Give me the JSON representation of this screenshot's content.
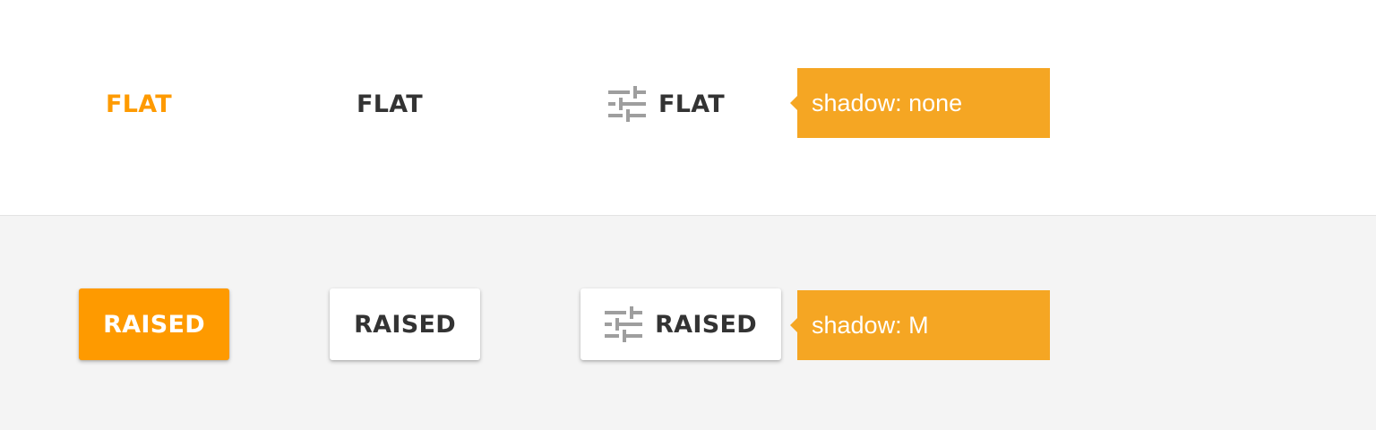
{
  "flat_row": {
    "primary_label": "FLAT",
    "default_label": "FLAT",
    "icon_label": "FLAT",
    "icon": "tune-sliders-icon",
    "tooltip": "shadow: none"
  },
  "raised_row": {
    "primary_label": "RAISED",
    "default_label": "RAISED",
    "icon_label": "RAISED",
    "icon": "tune-sliders-icon",
    "tooltip": "shadow: M"
  },
  "colors": {
    "accent": "#fe9a00",
    "tooltip_bg": "#f5a623",
    "text": "#333333",
    "icon": "#9e9e9e",
    "raised_background": "#f4f4f4"
  }
}
